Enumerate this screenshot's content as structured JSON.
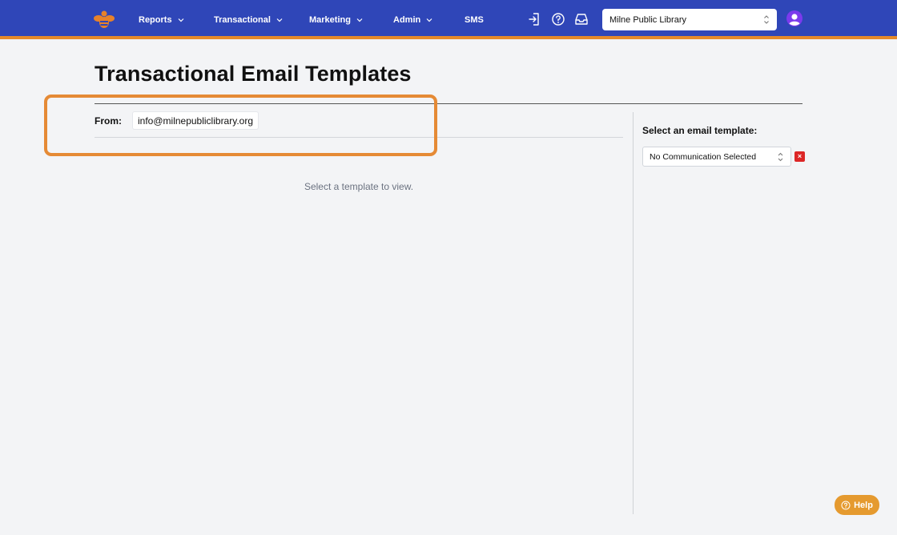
{
  "nav": {
    "items": [
      {
        "label": "Reports"
      },
      {
        "label": "Transactional"
      },
      {
        "label": "Marketing"
      },
      {
        "label": "Admin"
      },
      {
        "label": "SMS"
      }
    ],
    "org_select": "Milne Public Library"
  },
  "page": {
    "title": "Transactional Email Templates",
    "from_label": "From:",
    "from_value": "info@milnepubliclibrary.org",
    "empty_message": "Select a template to view."
  },
  "sidebar": {
    "label": "Select an email template:",
    "template_select": "No Communication Selected",
    "clear_symbol": "×"
  },
  "help": {
    "label": "Help"
  },
  "colors": {
    "nav_bg": "#2f46b8",
    "nav_accent": "#e58a2b",
    "highlight": "#e58a35",
    "help_bg": "#e59a2f",
    "clear_bg": "#dc2626"
  }
}
